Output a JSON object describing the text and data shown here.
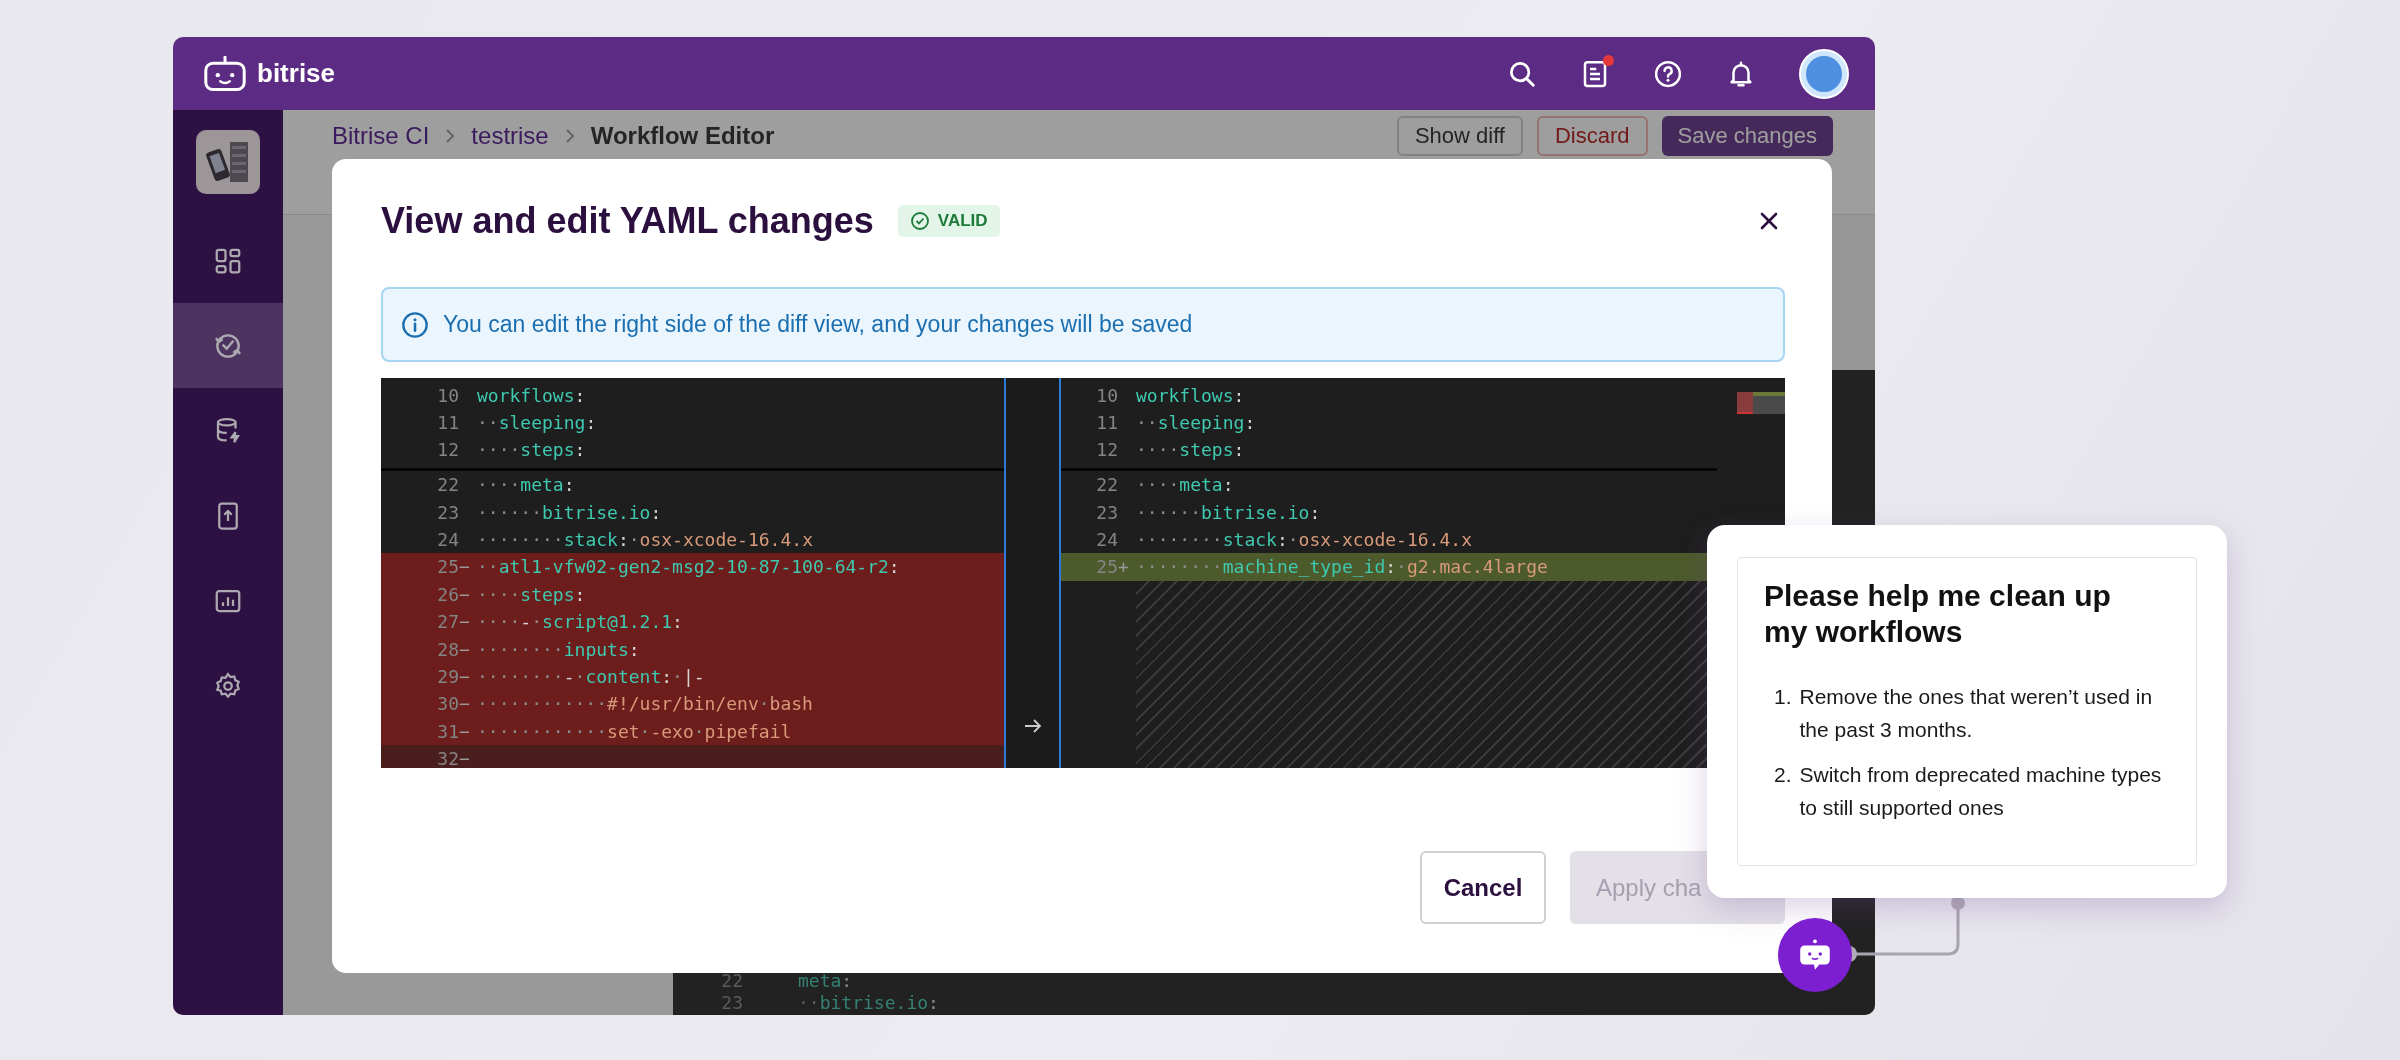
{
  "topbar": {
    "brand": "bitrise",
    "news_unread": true
  },
  "sidebar": {
    "nav": [
      {
        "selected": false
      },
      {
        "selected": true
      },
      {
        "selected": false
      },
      {
        "selected": false
      },
      {
        "selected": false
      },
      {
        "selected": false
      }
    ]
  },
  "page_header": {
    "breadcrumb": [
      "Bitrise CI",
      "testrise",
      "Workflow Editor"
    ],
    "buttons": [
      {
        "label": "Show diff",
        "kind": "outline"
      },
      {
        "label": "Discard",
        "kind": "danger"
      },
      {
        "label": "Save changes",
        "kind": "primary"
      }
    ]
  },
  "background_editor": {
    "lines": [
      {
        "number": "22",
        "code": [
          {
            "kind": "key",
            "text": "meta"
          },
          {
            "kind": "punct",
            "text": ":"
          }
        ]
      },
      {
        "number": "23",
        "code": [
          {
            "kind": "ws",
            "text": "··"
          },
          {
            "kind": "key",
            "text": "bitrise.io"
          },
          {
            "kind": "punct",
            "text": ":"
          }
        ]
      }
    ]
  },
  "modal": {
    "title": "View and edit YAML changes",
    "status": {
      "label": "VALID",
      "kind": "valid"
    },
    "info": "You can edit the right side of the diff view, and your changes will be saved",
    "diff": {
      "left": {
        "sticky": [
          {
            "number": "10",
            "code": [
              {
                "kind": "key",
                "text": "workflows"
              },
              {
                "kind": "punct",
                "text": ":"
              }
            ]
          },
          {
            "number": "11",
            "code": [
              {
                "kind": "ws",
                "text": "··"
              },
              {
                "kind": "key",
                "text": "sleeping"
              },
              {
                "kind": "punct",
                "text": ":"
              }
            ]
          },
          {
            "number": "12",
            "code": [
              {
                "kind": "ws",
                "text": "····"
              },
              {
                "kind": "key",
                "text": "steps"
              },
              {
                "kind": "punct",
                "text": ":"
              }
            ]
          }
        ],
        "lines": [
          {
            "number": "22",
            "kind": "normal",
            "code": [
              {
                "kind": "ws",
                "text": "····"
              },
              {
                "kind": "key",
                "text": "meta"
              },
              {
                "kind": "punct",
                "text": ":"
              }
            ]
          },
          {
            "number": "23",
            "kind": "normal",
            "code": [
              {
                "kind": "ws",
                "text": "······"
              },
              {
                "kind": "key",
                "text": "bitrise.io"
              },
              {
                "kind": "punct",
                "text": ":"
              }
            ]
          },
          {
            "number": "24",
            "kind": "normal",
            "code": [
              {
                "kind": "ws",
                "text": "········"
              },
              {
                "kind": "key",
                "text": "stack"
              },
              {
                "kind": "punct",
                "text": ":"
              },
              {
                "kind": "ws",
                "text": "·"
              },
              {
                "kind": "value",
                "text": "osx-xcode-16.4.x"
              }
            ]
          },
          {
            "number": "25",
            "marker": "−",
            "kind": "deleted",
            "code": [
              {
                "kind": "ws",
                "text": "··"
              },
              {
                "kind": "key",
                "text": "atl1-vfw02-gen2-msg2-10-87-100-64-r2"
              },
              {
                "kind": "punct",
                "text": ":"
              }
            ]
          },
          {
            "number": "26",
            "marker": "−",
            "kind": "deleted",
            "code": [
              {
                "kind": "ws",
                "text": "····"
              },
              {
                "kind": "key",
                "text": "steps"
              },
              {
                "kind": "punct",
                "text": ":"
              }
            ]
          },
          {
            "number": "27",
            "marker": "−",
            "kind": "deleted",
            "code": [
              {
                "kind": "ws",
                "text": "····"
              },
              {
                "kind": "punct",
                "text": "-"
              },
              {
                "kind": "ws",
                "text": "·"
              },
              {
                "kind": "key",
                "text": "script@1.2.1"
              },
              {
                "kind": "punct",
                "text": ":"
              }
            ]
          },
          {
            "number": "28",
            "marker": "−",
            "kind": "deleted",
            "code": [
              {
                "kind": "ws",
                "text": "········"
              },
              {
                "kind": "key",
                "text": "inputs"
              },
              {
                "kind": "punct",
                "text": ":"
              }
            ]
          },
          {
            "number": "29",
            "marker": "−",
            "kind": "deleted",
            "code": [
              {
                "kind": "ws",
                "text": "········"
              },
              {
                "kind": "punct",
                "text": "-"
              },
              {
                "kind": "ws",
                "text": "·"
              },
              {
                "kind": "key",
                "text": "content"
              },
              {
                "kind": "punct",
                "text": ":"
              },
              {
                "kind": "ws",
                "text": "·"
              },
              {
                "kind": "punct",
                "text": "|-"
              }
            ]
          },
          {
            "number": "30",
            "marker": "−",
            "kind": "deleted",
            "code": [
              {
                "kind": "ws",
                "text": "············"
              },
              {
                "kind": "value",
                "text": "#!/usr/bin/env"
              },
              {
                "kind": "ws",
                "text": "·"
              },
              {
                "kind": "value",
                "text": "bash"
              }
            ]
          },
          {
            "number": "31",
            "marker": "−",
            "kind": "deleted",
            "code": [
              {
                "kind": "ws",
                "text": "············"
              },
              {
                "kind": "value",
                "text": "set"
              },
              {
                "kind": "ws",
                "text": "·"
              },
              {
                "kind": "value",
                "text": "-exo"
              },
              {
                "kind": "ws",
                "text": "·"
              },
              {
                "kind": "value",
                "text": "pipefail"
              }
            ]
          },
          {
            "number": "32",
            "marker": "−",
            "kind": "deleted_dim"
          }
        ]
      },
      "right": {
        "sticky": [
          {
            "number": "10",
            "code": [
              {
                "kind": "key",
                "text": "workflows"
              },
              {
                "kind": "punct",
                "text": ":"
              }
            ]
          },
          {
            "number": "11",
            "code": [
              {
                "kind": "ws",
                "text": "··"
              },
              {
                "kind": "key",
                "text": "sleeping"
              },
              {
                "kind": "punct",
                "text": ":"
              }
            ]
          },
          {
            "number": "12",
            "code": [
              {
                "kind": "ws",
                "text": "····"
              },
              {
                "kind": "key",
                "text": "steps"
              },
              {
                "kind": "punct",
                "text": ":"
              }
            ]
          }
        ],
        "lines": [
          {
            "number": "22",
            "kind": "normal",
            "code": [
              {
                "kind": "ws",
                "text": "····"
              },
              {
                "kind": "key",
                "text": "meta"
              },
              {
                "kind": "punct",
                "text": ":"
              }
            ]
          },
          {
            "number": "23",
            "kind": "normal",
            "code": [
              {
                "kind": "ws",
                "text": "······"
              },
              {
                "kind": "key",
                "text": "bitrise.io"
              },
              {
                "kind": "punct",
                "text": ":"
              }
            ]
          },
          {
            "number": "24",
            "kind": "normal",
            "code": [
              {
                "kind": "ws",
                "text": "········"
              },
              {
                "kind": "key",
                "text": "stack"
              },
              {
                "kind": "punct",
                "text": ":"
              },
              {
                "kind": "ws",
                "text": "·"
              },
              {
                "kind": "value",
                "text": "osx-xcode-16.4.x"
              }
            ]
          },
          {
            "number": "25",
            "marker": "+",
            "kind": "added",
            "code": [
              {
                "kind": "ws",
                "text": "········"
              },
              {
                "kind": "key",
                "text": "machine_type_id"
              },
              {
                "kind": "punct",
                "text": ":"
              },
              {
                "kind": "ws",
                "text": "·"
              },
              {
                "kind": "value",
                "text": "g2.mac.4large"
              }
            ]
          }
        ]
      }
    },
    "buttons": [
      {
        "label": "Cancel",
        "kind": "secondary",
        "disabled": false
      },
      {
        "label": "Apply cha",
        "kind": "primary",
        "disabled": true
      }
    ]
  },
  "chat": {
    "title": "Please help me clean up my workflows",
    "steps": [
      {
        "number": "1.",
        "text": "Remove the ones that weren’t used in the past 3 months."
      },
      {
        "number": "2.",
        "text": "Switch from deprecated machine types to still supported ones"
      }
    ]
  }
}
